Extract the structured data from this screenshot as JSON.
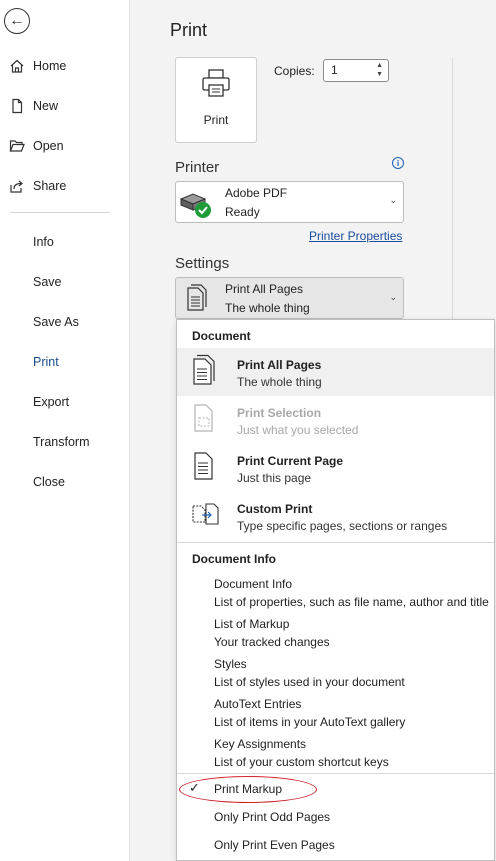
{
  "sidebar": {
    "items": [
      {
        "label": "Home"
      },
      {
        "label": "New"
      },
      {
        "label": "Open"
      },
      {
        "label": "Share"
      },
      {
        "label": "Info"
      },
      {
        "label": "Save"
      },
      {
        "label": "Save As"
      },
      {
        "label": "Print"
      },
      {
        "label": "Export"
      },
      {
        "label": "Transform"
      },
      {
        "label": "Close"
      }
    ],
    "active": "Print"
  },
  "main": {
    "title": "Print",
    "print_button_label": "Print",
    "copies_label": "Copies:",
    "copies_value": "1",
    "printer_heading": "Printer",
    "printer_name": "Adobe PDF",
    "printer_status": "Ready",
    "printer_properties_link": "Printer Properties",
    "settings_heading": "Settings",
    "settings_selected_title": "Print All Pages",
    "settings_selected_desc": "The whole thing"
  },
  "dropdown": {
    "document_heading": "Document",
    "document_items": [
      {
        "title": "Print All Pages",
        "desc": "The whole thing"
      },
      {
        "title": "Print Selection",
        "desc": "Just what you selected"
      },
      {
        "title": "Print Current Page",
        "desc": "Just this page"
      },
      {
        "title": "Custom Print",
        "desc": "Type specific pages, sections or ranges"
      }
    ],
    "document_info_heading": "Document Info",
    "document_info_items": [
      {
        "title": "Document Info",
        "desc": "List of properties, such as file name, author and title"
      },
      {
        "title": "List of Markup",
        "desc": "Your tracked changes"
      },
      {
        "title": "Styles",
        "desc": "List of styles used in your document"
      },
      {
        "title": "AutoText Entries",
        "desc": "List of items in your AutoText gallery"
      },
      {
        "title": "Key Assignments",
        "desc": "List of your custom shortcut keys"
      }
    ],
    "options": [
      {
        "label": "Print Markup",
        "checked": true
      },
      {
        "label": "Only Print Odd Pages"
      },
      {
        "label": "Only Print Even Pages"
      }
    ]
  },
  "colors": {
    "accent": "#1a4b8c",
    "highlight_circle": "#d0202a",
    "status_green": "#1f9d3a"
  }
}
